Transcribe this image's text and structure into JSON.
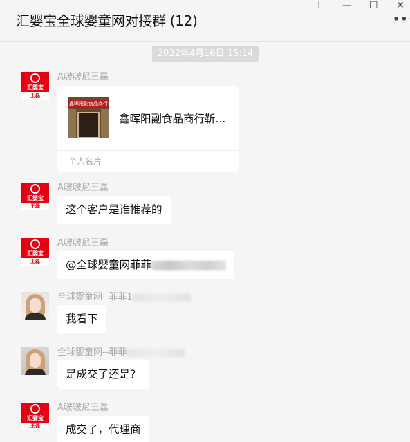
{
  "window": {
    "title": "汇婴宝全球婴童网对接群 (12)",
    "controls": {
      "pin": "⊥",
      "minimize": "—",
      "maximize": "☐",
      "close": "✕"
    },
    "more": "•••"
  },
  "timestamp": "2022年4月16日 15:14",
  "avatar_logo": {
    "brand": "汇婴宝",
    "tag": "王磊"
  },
  "messages": [
    {
      "sender": "A啵啵尼王磊",
      "type": "contact_card",
      "card": {
        "name": "鑫晖阳副食品商行靳...",
        "image_sign": "鑫晖阳副食品商行",
        "footer": "个人名片"
      }
    },
    {
      "sender": "A啵啵尼王磊",
      "text": "这个客户是谁推荐的"
    },
    {
      "sender": "A啵啵尼王磊",
      "text": "@全球婴童网菲菲"
    },
    {
      "sender": "全球婴童网--菲菲1",
      "text": "我看下"
    },
    {
      "sender": "全球婴童网--菲菲",
      "text": "是成交了还是？"
    },
    {
      "sender": "A啵啵尼王磊",
      "text": "成交了，代理商"
    }
  ]
}
